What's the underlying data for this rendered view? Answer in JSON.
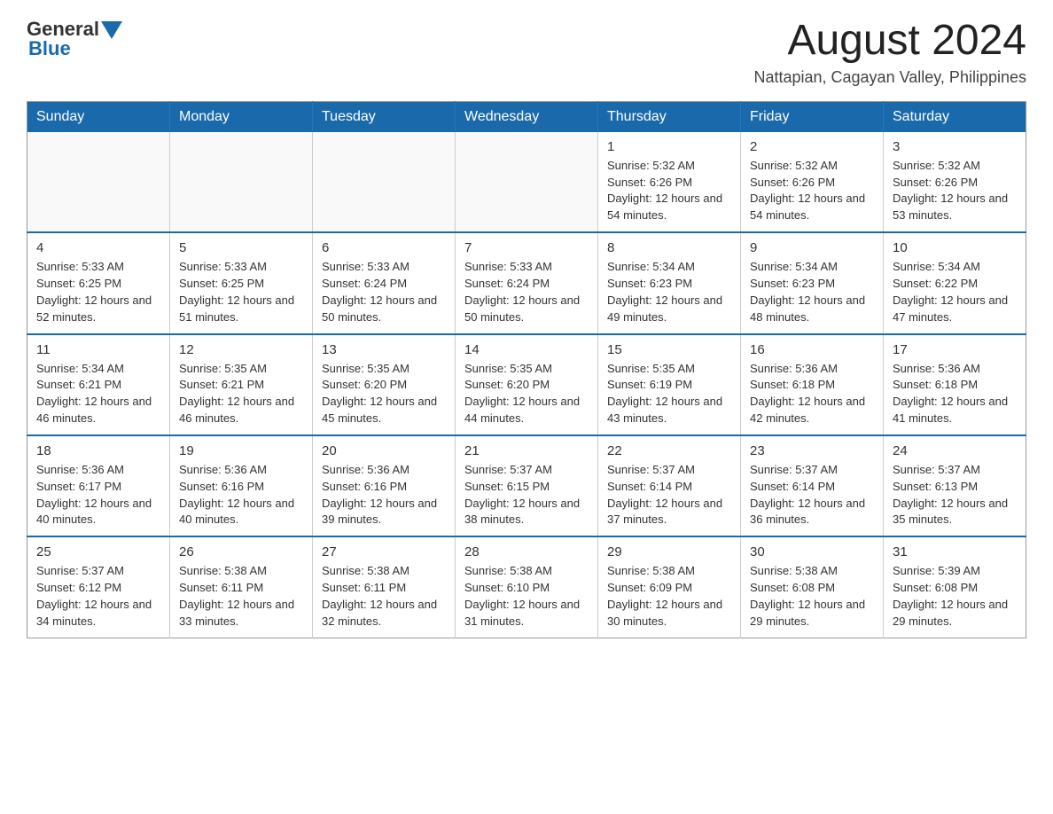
{
  "header": {
    "logo_general": "General",
    "logo_blue": "Blue",
    "month_year": "August 2024",
    "location": "Nattapian, Cagayan Valley, Philippines"
  },
  "weekdays": [
    "Sunday",
    "Monday",
    "Tuesday",
    "Wednesday",
    "Thursday",
    "Friday",
    "Saturday"
  ],
  "weeks": [
    [
      {
        "day": "",
        "info": ""
      },
      {
        "day": "",
        "info": ""
      },
      {
        "day": "",
        "info": ""
      },
      {
        "day": "",
        "info": ""
      },
      {
        "day": "1",
        "info": "Sunrise: 5:32 AM\nSunset: 6:26 PM\nDaylight: 12 hours and 54 minutes."
      },
      {
        "day": "2",
        "info": "Sunrise: 5:32 AM\nSunset: 6:26 PM\nDaylight: 12 hours and 54 minutes."
      },
      {
        "day": "3",
        "info": "Sunrise: 5:32 AM\nSunset: 6:26 PM\nDaylight: 12 hours and 53 minutes."
      }
    ],
    [
      {
        "day": "4",
        "info": "Sunrise: 5:33 AM\nSunset: 6:25 PM\nDaylight: 12 hours and 52 minutes."
      },
      {
        "day": "5",
        "info": "Sunrise: 5:33 AM\nSunset: 6:25 PM\nDaylight: 12 hours and 51 minutes."
      },
      {
        "day": "6",
        "info": "Sunrise: 5:33 AM\nSunset: 6:24 PM\nDaylight: 12 hours and 50 minutes."
      },
      {
        "day": "7",
        "info": "Sunrise: 5:33 AM\nSunset: 6:24 PM\nDaylight: 12 hours and 50 minutes."
      },
      {
        "day": "8",
        "info": "Sunrise: 5:34 AM\nSunset: 6:23 PM\nDaylight: 12 hours and 49 minutes."
      },
      {
        "day": "9",
        "info": "Sunrise: 5:34 AM\nSunset: 6:23 PM\nDaylight: 12 hours and 48 minutes."
      },
      {
        "day": "10",
        "info": "Sunrise: 5:34 AM\nSunset: 6:22 PM\nDaylight: 12 hours and 47 minutes."
      }
    ],
    [
      {
        "day": "11",
        "info": "Sunrise: 5:34 AM\nSunset: 6:21 PM\nDaylight: 12 hours and 46 minutes."
      },
      {
        "day": "12",
        "info": "Sunrise: 5:35 AM\nSunset: 6:21 PM\nDaylight: 12 hours and 46 minutes."
      },
      {
        "day": "13",
        "info": "Sunrise: 5:35 AM\nSunset: 6:20 PM\nDaylight: 12 hours and 45 minutes."
      },
      {
        "day": "14",
        "info": "Sunrise: 5:35 AM\nSunset: 6:20 PM\nDaylight: 12 hours and 44 minutes."
      },
      {
        "day": "15",
        "info": "Sunrise: 5:35 AM\nSunset: 6:19 PM\nDaylight: 12 hours and 43 minutes."
      },
      {
        "day": "16",
        "info": "Sunrise: 5:36 AM\nSunset: 6:18 PM\nDaylight: 12 hours and 42 minutes."
      },
      {
        "day": "17",
        "info": "Sunrise: 5:36 AM\nSunset: 6:18 PM\nDaylight: 12 hours and 41 minutes."
      }
    ],
    [
      {
        "day": "18",
        "info": "Sunrise: 5:36 AM\nSunset: 6:17 PM\nDaylight: 12 hours and 40 minutes."
      },
      {
        "day": "19",
        "info": "Sunrise: 5:36 AM\nSunset: 6:16 PM\nDaylight: 12 hours and 40 minutes."
      },
      {
        "day": "20",
        "info": "Sunrise: 5:36 AM\nSunset: 6:16 PM\nDaylight: 12 hours and 39 minutes."
      },
      {
        "day": "21",
        "info": "Sunrise: 5:37 AM\nSunset: 6:15 PM\nDaylight: 12 hours and 38 minutes."
      },
      {
        "day": "22",
        "info": "Sunrise: 5:37 AM\nSunset: 6:14 PM\nDaylight: 12 hours and 37 minutes."
      },
      {
        "day": "23",
        "info": "Sunrise: 5:37 AM\nSunset: 6:14 PM\nDaylight: 12 hours and 36 minutes."
      },
      {
        "day": "24",
        "info": "Sunrise: 5:37 AM\nSunset: 6:13 PM\nDaylight: 12 hours and 35 minutes."
      }
    ],
    [
      {
        "day": "25",
        "info": "Sunrise: 5:37 AM\nSunset: 6:12 PM\nDaylight: 12 hours and 34 minutes."
      },
      {
        "day": "26",
        "info": "Sunrise: 5:38 AM\nSunset: 6:11 PM\nDaylight: 12 hours and 33 minutes."
      },
      {
        "day": "27",
        "info": "Sunrise: 5:38 AM\nSunset: 6:11 PM\nDaylight: 12 hours and 32 minutes."
      },
      {
        "day": "28",
        "info": "Sunrise: 5:38 AM\nSunset: 6:10 PM\nDaylight: 12 hours and 31 minutes."
      },
      {
        "day": "29",
        "info": "Sunrise: 5:38 AM\nSunset: 6:09 PM\nDaylight: 12 hours and 30 minutes."
      },
      {
        "day": "30",
        "info": "Sunrise: 5:38 AM\nSunset: 6:08 PM\nDaylight: 12 hours and 29 minutes."
      },
      {
        "day": "31",
        "info": "Sunrise: 5:39 AM\nSunset: 6:08 PM\nDaylight: 12 hours and 29 minutes."
      }
    ]
  ]
}
